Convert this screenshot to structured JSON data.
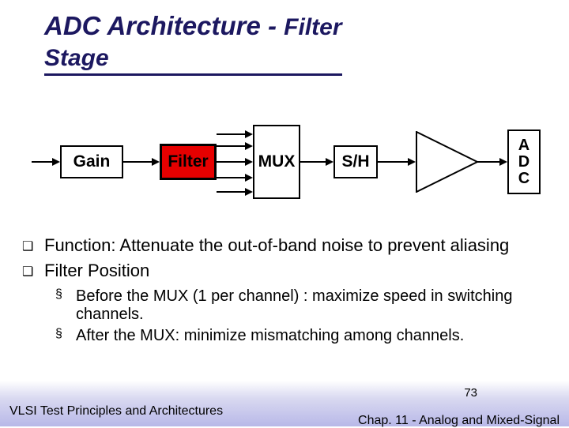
{
  "title_main": "ADC Architecture - ",
  "title_sub1": "Filter",
  "title_sub2": "Stage",
  "blocks": {
    "gain": "Gain",
    "filter": "Filter",
    "mux": "MUX",
    "sh": "S/H",
    "adc": "A\nD\nC"
  },
  "bullets": {
    "b1": "Function: Attenuate the out-of-band noise to prevent aliasing",
    "b2": "Filter Position"
  },
  "sub_bullets": {
    "s1": "Before the MUX (1 per channel) : maximize speed in switching channels.",
    "s2": "After the MUX: minimize mismatching among channels."
  },
  "footer": {
    "left": "VLSI Test Principles and Architectures",
    "right": "Chap. 11 - Analog and Mixed-Signal",
    "page": "73"
  }
}
